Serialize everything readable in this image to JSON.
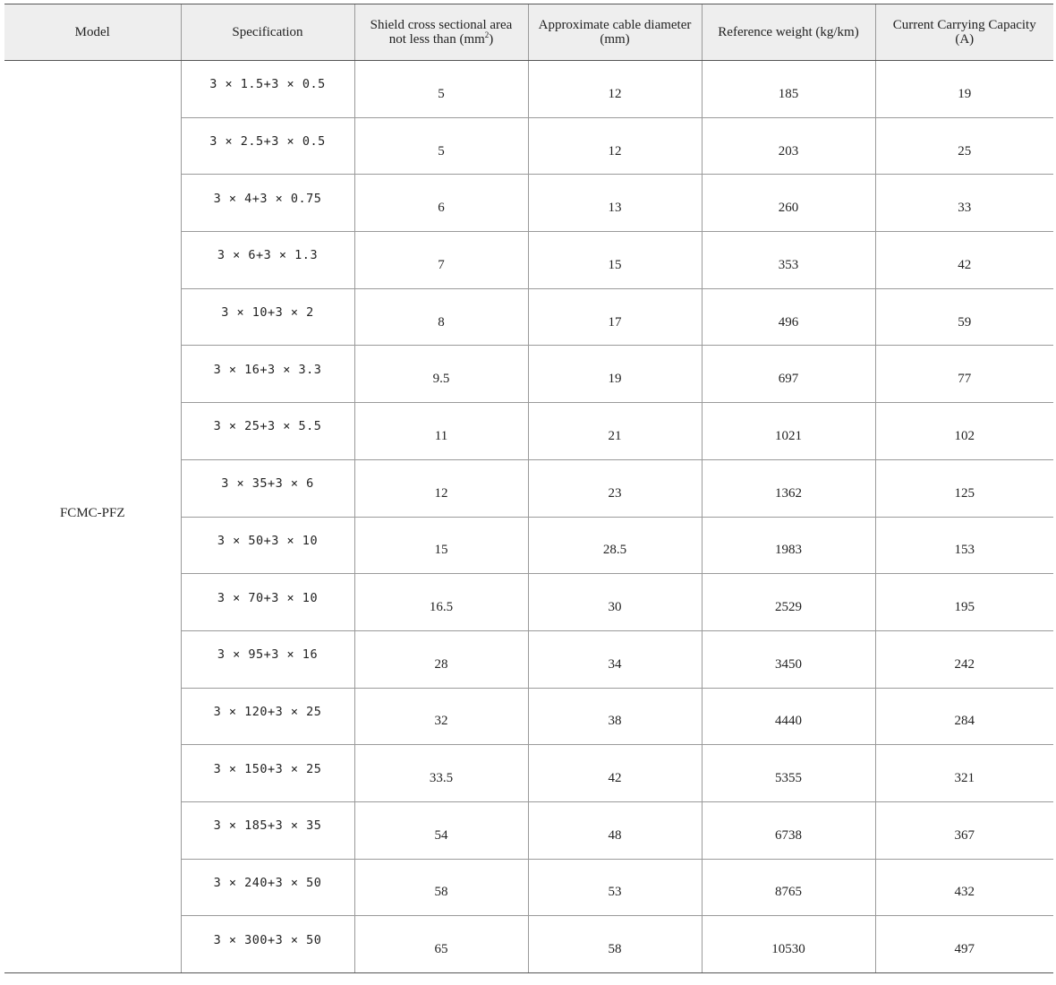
{
  "table": {
    "headers": {
      "model": "Model",
      "specification": "Specification",
      "shield_line1": "Shield cross sectional area",
      "shield_line2_prefix": "not less than (mm",
      "shield_line2_sup": "2",
      "shield_line2_suffix": ")",
      "diameter_line1": "Approximate cable diameter",
      "diameter_line2": "(mm)",
      "weight": "Reference weight (kg/km)",
      "current_line1": "Current Carrying Capacity",
      "current_line2": "(A)"
    },
    "model_value": "FCMC-PFZ",
    "rows": [
      {
        "spec": "3 × 1.5+3 × 0.5",
        "shield": "5",
        "diameter": "12",
        "weight": "185",
        "current": "19"
      },
      {
        "spec": "3 × 2.5+3 × 0.5",
        "shield": "5",
        "diameter": "12",
        "weight": "203",
        "current": "25"
      },
      {
        "spec": "3 × 4+3 × 0.75",
        "shield": "6",
        "diameter": "13",
        "weight": "260",
        "current": "33"
      },
      {
        "spec": "3 × 6+3 × 1.3",
        "shield": "7",
        "diameter": "15",
        "weight": "353",
        "current": "42"
      },
      {
        "spec": "3 × 10+3 × 2",
        "shield": "8",
        "diameter": "17",
        "weight": "496",
        "current": "59"
      },
      {
        "spec": "3 × 16+3 × 3.3",
        "shield": "9.5",
        "diameter": "19",
        "weight": "697",
        "current": "77"
      },
      {
        "spec": "3 × 25+3 × 5.5",
        "shield": "11",
        "diameter": "21",
        "weight": "1021",
        "current": "102"
      },
      {
        "spec": "3 × 35+3 × 6",
        "shield": "12",
        "diameter": "23",
        "weight": "1362",
        "current": "125"
      },
      {
        "spec": "3 × 50+3 × 10",
        "shield": "15",
        "diameter": "28.5",
        "weight": "1983",
        "current": "153"
      },
      {
        "spec": "3 × 70+3 × 10",
        "shield": "16.5",
        "diameter": "30",
        "weight": "2529",
        "current": "195"
      },
      {
        "spec": "3 × 95+3 × 16",
        "shield": "28",
        "diameter": "34",
        "weight": "3450",
        "current": "242"
      },
      {
        "spec": "3 × 120+3 × 25",
        "shield": "32",
        "diameter": "38",
        "weight": "4440",
        "current": "284"
      },
      {
        "spec": "3 × 150+3 × 25",
        "shield": "33.5",
        "diameter": "42",
        "weight": "5355",
        "current": "321"
      },
      {
        "spec": "3 × 185+3 × 35",
        "shield": "54",
        "diameter": "48",
        "weight": "6738",
        "current": "367"
      },
      {
        "spec": "3 × 240+3 × 50",
        "shield": "58",
        "diameter": "53",
        "weight": "8765",
        "current": "432"
      },
      {
        "spec": "3 × 300+3 × 50",
        "shield": "65",
        "diameter": "58",
        "weight": "10530",
        "current": "497"
      }
    ]
  }
}
